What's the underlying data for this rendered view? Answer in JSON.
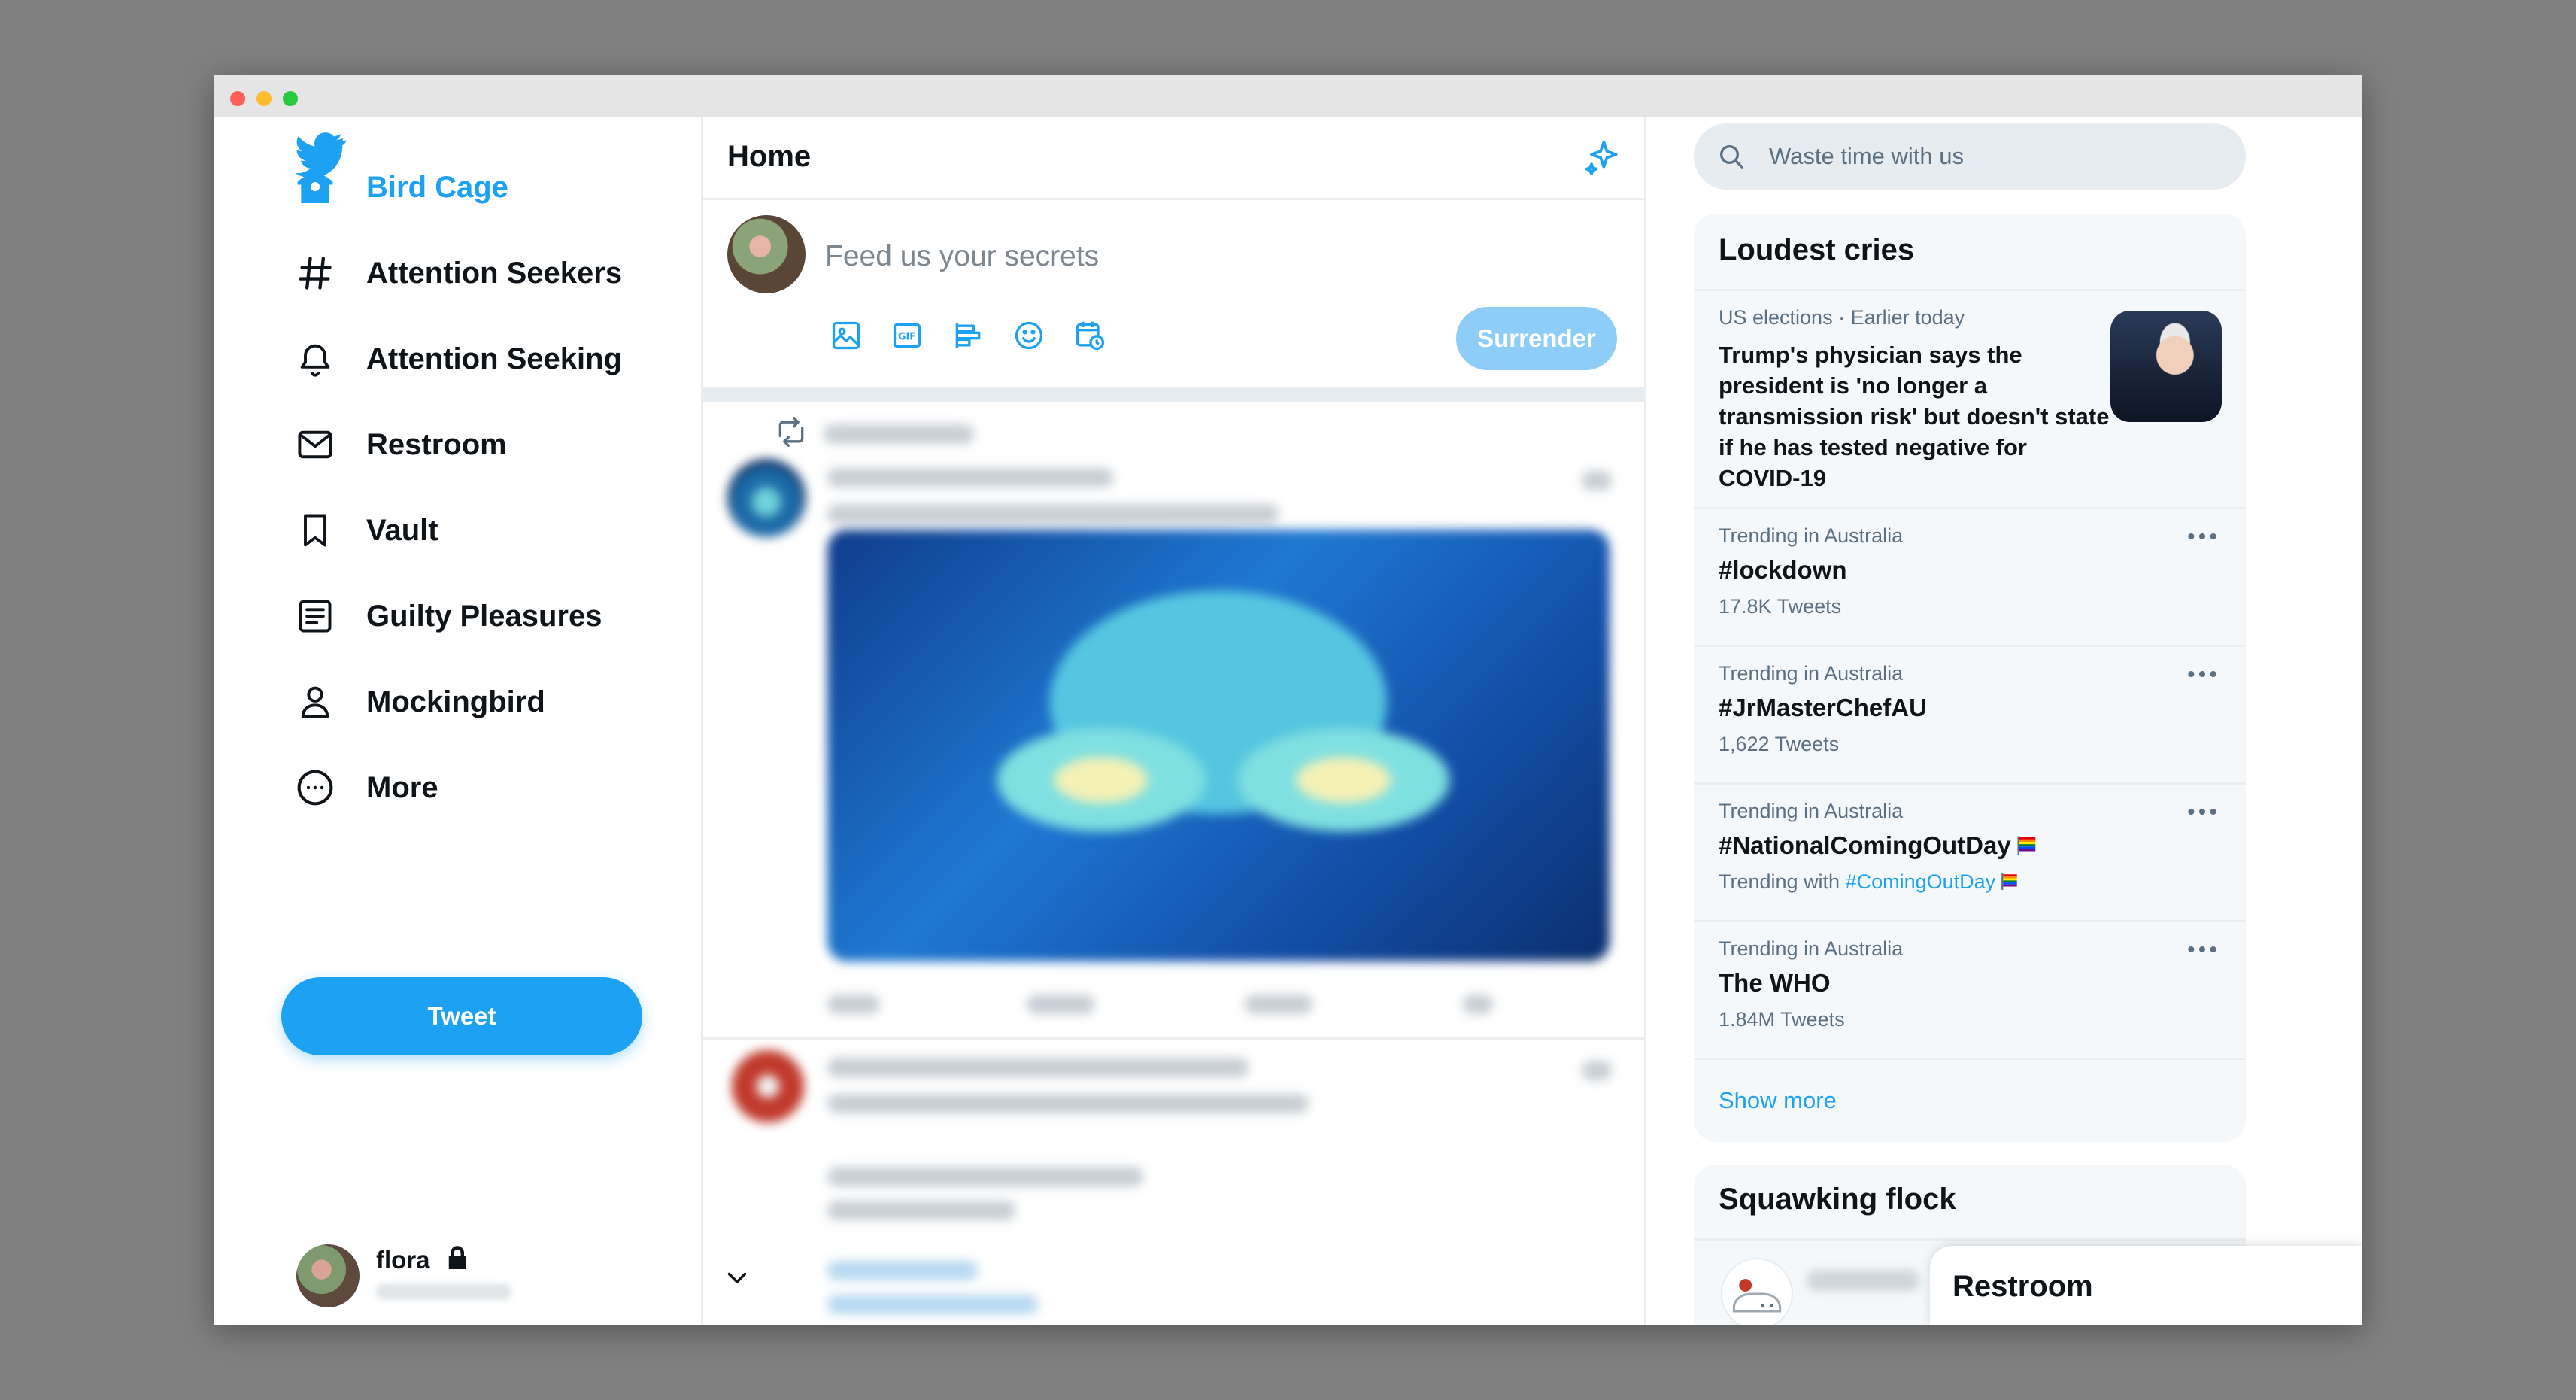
{
  "window": {
    "controls": [
      "close",
      "minimize",
      "zoom"
    ]
  },
  "sidebar": {
    "logo": "bird-logo",
    "items": [
      {
        "label": "Bird Cage",
        "icon": "home-icon",
        "active": true
      },
      {
        "label": "Attention Seekers",
        "icon": "hashtag-icon"
      },
      {
        "label": "Attention Seeking",
        "icon": "bell-icon"
      },
      {
        "label": "Restroom",
        "icon": "envelope-icon"
      },
      {
        "label": "Vault",
        "icon": "bookmark-icon"
      },
      {
        "label": "Guilty Pleasures",
        "icon": "list-icon"
      },
      {
        "label": "Mockingbird",
        "icon": "profile-icon"
      },
      {
        "label": "More",
        "icon": "more-circle-icon"
      }
    ],
    "tweet_button": "Tweet",
    "account": {
      "name": "flora",
      "icon": "lock-icon"
    }
  },
  "feed": {
    "title": "Home",
    "composer": {
      "placeholder": "Feed us your secrets",
      "tools": [
        "image-icon",
        "gif-icon",
        "poll-icon",
        "emoji-icon",
        "schedule-icon"
      ],
      "submit_label": "Surrender"
    }
  },
  "search": {
    "placeholder": "Waste time with us"
  },
  "trends": {
    "title": "Loudest cries",
    "news": {
      "meta": "US elections · Earlier today",
      "headline": "Trump's physician says the president is 'no longer a transmission risk' but doesn't state if he has tested negative for COVID-19"
    },
    "items": [
      {
        "context": "Trending in Australia",
        "tag": "#lockdown",
        "detail": "17.8K Tweets"
      },
      {
        "context": "Trending in Australia",
        "tag": "#JrMasterChefAU",
        "detail": "1,622 Tweets"
      },
      {
        "context": "Trending in Australia",
        "tag": "#NationalComingOutDay",
        "detail_prefix": "Trending with",
        "detail_link": "#ComingOutDay"
      },
      {
        "context": "Trending in Australia",
        "tag": "The WHO",
        "detail": "1.84M Tweets"
      }
    ],
    "show_more": "Show more"
  },
  "who_to_follow": {
    "title": "Squawking flock"
  },
  "messages_drawer": {
    "title": "Restroom"
  },
  "colors": {
    "accent": "#1da1f2",
    "text": "#0f1419",
    "muted": "#5b7083",
    "panel": "#f5f8fa"
  }
}
